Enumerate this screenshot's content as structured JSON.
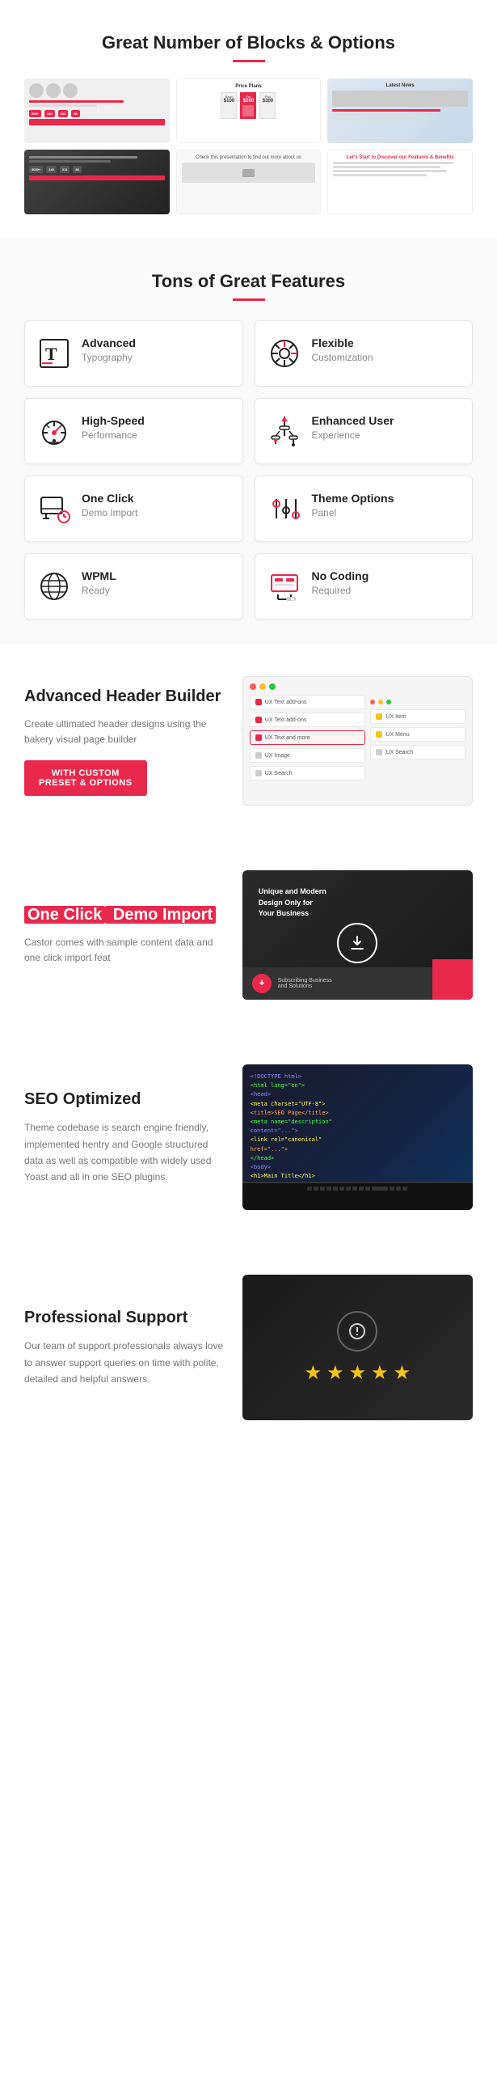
{
  "section1": {
    "title": "Great Number of Blocks & Options",
    "divider_color": "#e8294c"
  },
  "section2": {
    "title": "Tons of Great Features",
    "features": [
      {
        "id": "advanced-typography",
        "icon": "typography-icon",
        "title": "Advanced",
        "subtitle": "Typography"
      },
      {
        "id": "flexible-customization",
        "icon": "gear-icon",
        "title": "Flexible",
        "subtitle": "Customization"
      },
      {
        "id": "high-speed",
        "icon": "speed-icon",
        "title": "High-Speed",
        "subtitle": "Performance"
      },
      {
        "id": "enhanced-user",
        "icon": "user-icon",
        "title": "Enhanced User",
        "subtitle": "Experience"
      },
      {
        "id": "one-click",
        "icon": "click-icon",
        "title": "One Click",
        "subtitle": "Demo Import"
      },
      {
        "id": "theme-options",
        "icon": "sliders-icon",
        "title": "Theme Options",
        "subtitle": "Panel"
      },
      {
        "id": "wpml",
        "icon": "globe-icon",
        "title": "WPML",
        "subtitle": "Ready"
      },
      {
        "id": "no-coding",
        "icon": "code-icon",
        "title": "No Coding",
        "subtitle": "Required"
      }
    ]
  },
  "section3": {
    "title": "Advanced Header Builder",
    "description": "Create ultimated header designs using the bakery visual page builder",
    "button_label": "WITH CUSTOM\nPreset & Options",
    "button_line1": "WITH CUSTOM",
    "button_line2": "Preset & Options",
    "rows_left": [
      {
        "label": "UX Text add-ons",
        "color": "red"
      },
      {
        "label": "UX Text add-ons",
        "color": "red"
      },
      {
        "label": "UX Text and more",
        "color": "red"
      },
      {
        "label": "UX Image",
        "color": "gray"
      },
      {
        "label": "UX Search",
        "color": "gray"
      }
    ],
    "rows_right": [
      {
        "label": "UX Item",
        "color": "yellow"
      },
      {
        "label": "UX Menu",
        "color": "yellow"
      },
      {
        "label": "UX Search",
        "color": "gray"
      }
    ]
  },
  "section4": {
    "title_highlight": "One Click",
    "title_rest": " Demo Import",
    "description": "Castor comes with sample content data and one click import feat",
    "overlay_text": "Unique and Modern\nDesign Only for\nYour Business"
  },
  "section5": {
    "title": "SEO Optimized",
    "description": "Theme codebase is search engine friendly, implemented hentry and Google structured data as well as compatible with widely used Yoast and all in one SEO plugins."
  },
  "section6": {
    "title": "Professional Support",
    "description": "Our team of support professionals always love to answer support queries on time with polite, detailed and helpful answers.",
    "stars": [
      "★",
      "★",
      "★",
      "★",
      "★"
    ]
  }
}
